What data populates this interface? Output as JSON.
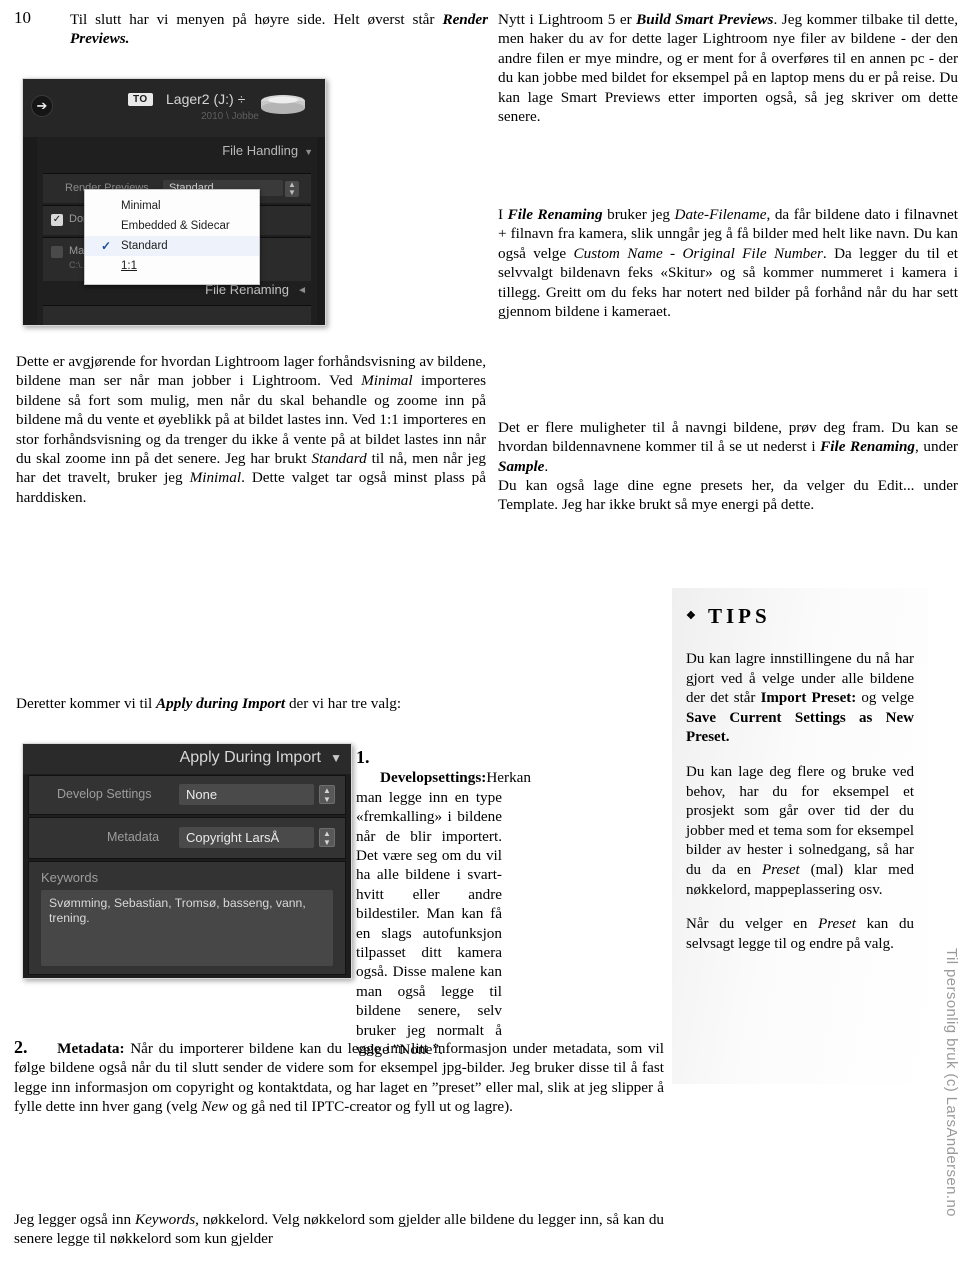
{
  "page": {
    "folio": "10",
    "credit_vertical": "Til personlig bruk (c) LarsAndersen.no"
  },
  "left_column": {
    "intro_p1_a": "Til slutt har vi menyen på høyre side. Helt øverst står ",
    "intro_p1_b": "Render Previews.",
    "p2_a": "Dette er avgjørende for hvordan Lightroom  lager forhåndsvisning av bildene, bildene man ser når man jobber i Lightroom. Ved ",
    "p2_b": "Minimal",
    "p2_c": " importeres bildene så fort som mulig, men når du skal behandle og zoome inn på bildene må du vente et øyeblikk på at bildet lastes inn. Ved 1:1 importeres en stor forhåndsvisning og da trenger du ikke å vente på at bildet lastes inn når du skal zoome inn på det senere. Jeg har brukt ",
    "p2_d": "Standard",
    "p2_e": " til nå, men når jeg har det travelt, bruker jeg ",
    "p2_f": "Minimal",
    "p2_g": ". Dette valget tar også minst plass på harddisken.",
    "p3_a": "Deretter kommer vi til ",
    "p3_b": "Apply during Import",
    "p3_c": " der vi har tre valg:"
  },
  "right_column": {
    "p1_a": "Nytt i Lightroom 5 er ",
    "p1_b": "Build Smart Previews",
    "p1_c": ". Jeg kommer tilbake til dette, men haker du av for dette lager Lightroom  nye filer av bildene - der den andre filen er mye mindre, og er ment for å overføres til en annen pc - der du kan jobbe med bildet for eksempel på en laptop mens du er på reise. Du kan lage Smart Previews etter importen også, så jeg skriver om dette senere.",
    "p2_a": "I ",
    "p2_b": "File Renaming",
    "p2_c": " bruker jeg ",
    "p2_d": "Date-Filename",
    "p2_e": ", da får bildene dato i filnavnet + filnavn fra kamera, slik unngår jeg å få bilder med helt like navn. Du kan også velge ",
    "p2_f": "Custom Name - Original File Number",
    "p2_g": ". Da legger du til et selvvalgt bildenavn feks «Skitur» og så kommer nummeret i kamera i tillegg. Greitt om du feks har notert ned bilder på forhånd når du har sett gjennom bildene i kameraet.",
    "p3_a": "Det er flere muligheter til å navngi bildene, prøv deg fram. Du kan se hvordan bildennavnene kommer til å se ut nederst i ",
    "p3_b": "File Renaming",
    "p3_c": ", under ",
    "p3_d": "Sample",
    "p3_e": ".",
    "p4": "Du kan også lage dine egne presets her, da velger du Edit... under Template. Jeg har ikke brukt så mye energi på dette."
  },
  "list": {
    "item1_num": "1.",
    "item1_bold": "Developsettings:",
    "item1_text": "Herkan man legge inn en type «fremkalling» i bildene når de blir importert. Det være seg om du vil ha alle bildene i svart-hvitt eller andre bildestiler. Man kan få en slags autofunksjon tilpasset ditt kamera også. Disse malene kan man også legge til bildene senere, selv bruker jeg normalt å velge ”None”.",
    "item2_num": "2.",
    "item2_bold": "Metadata:",
    "item2_a": " Når du importerer bildene kan du legge inn litt informasjon under metadata, som vil følge bildene også når du til slutt sender de videre som for eksempel jpg-bilder. Jeg bruker disse til å fast legge inn informasjon om copyright og kontaktdata, og har laget en ”preset” eller mal, slik at jeg slipper å fylle dette inn hver gang (velg ",
    "item2_b": "New",
    "item2_c": " og gå ned til IPTC-creator og fyll ut og lagre).",
    "closing_a": "Jeg legger også inn ",
    "closing_b": "Keywords",
    "closing_c": ", nøkkelord. Velg nøkkelord som gjelder alle bildene du legger inn, så kan du senere legge til nøkkelord som kun gjelder"
  },
  "tips": {
    "title": "TIPS",
    "bullet_icon": "diamond-bullet-icon",
    "p1_a": "Du kan lagre innstillingene du nå har gjort ved å velge under alle bildene der det står ",
    "p1_b": "Import Preset:",
    "p1_c": " og velge ",
    "p1_d": "Save Current Settings as New Preset.",
    "p2_a": "Du kan lage deg flere og bruke ved behov, har du for eksempel et prosjekt som går over tid der du jobber med et tema som for eksempel bilder av hester i solnedgang, så har du da en ",
    "p2_b": "Preset",
    "p2_c": " (mal) klar med nøkkelord, mappeplassering osv.",
    "p3_a": "Når du velger en ",
    "p3_b": "Preset",
    "p3_c": " kan du selvsagt  legge til og endre på valg."
  },
  "screenshot_file_handling": {
    "name": "lightroom-import-file-handling-panel",
    "back_icon": "arrow-right-circle-icon",
    "to_badge": "TO",
    "drive_label": "Lager2 (J:)",
    "drive_caret": "÷",
    "drive_path": "2010 \\ Jobbe",
    "hdd_icon": "hard-drive-icon",
    "section_title": "File Handling",
    "section_caret": "▼",
    "render_previews_label": "Render Previews",
    "render_previews_value": "Standard",
    "row_a_label": "Don't Import Suspected Duplicates",
    "row_b_label": "Make a Second Copy To:",
    "row_b_sub": "C:\\...\\Pictures",
    "file_renaming_label": "File Renaming",
    "file_renaming_caret": "◄",
    "dropdown_options": [
      {
        "label": "Minimal",
        "checked": false,
        "underline": false
      },
      {
        "label": "Embedded & Sidecar",
        "checked": false,
        "underline": false
      },
      {
        "label": "Standard",
        "checked": true,
        "underline": false
      },
      {
        "label": "1:1",
        "checked": false,
        "underline": true
      }
    ],
    "check_glyph": "✓"
  },
  "screenshot_apply_during_import": {
    "name": "lightroom-apply-during-import-panel",
    "title": "Apply During Import",
    "title_caret": "▼",
    "develop_settings_label": "Develop Settings",
    "develop_settings_value": "None",
    "metadata_label": "Metadata",
    "metadata_value": "Copyright LarsÅ",
    "keywords_label": "Keywords",
    "keywords_value": "Svømming, Sebastian, Tromsø, basseng, vann, trening.",
    "stepper_glyph": "⇕"
  }
}
